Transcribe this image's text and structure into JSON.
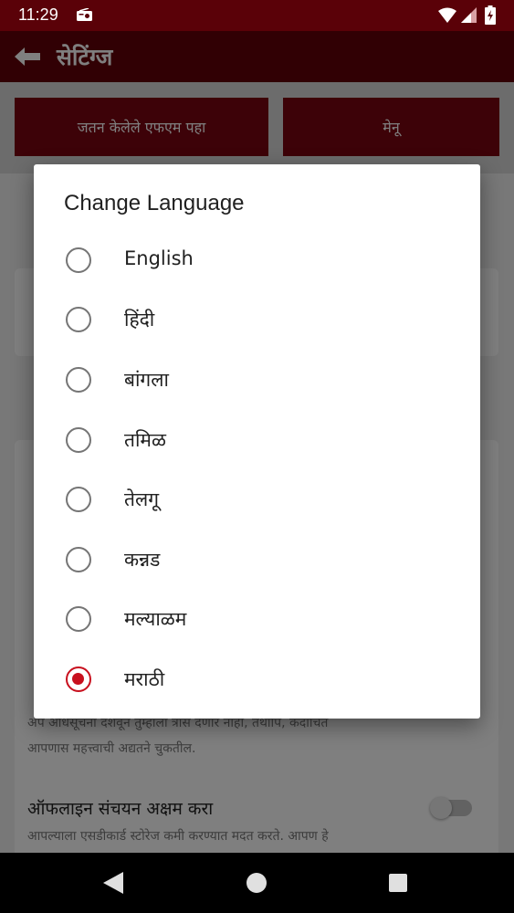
{
  "status_bar": {
    "time": "11:29"
  },
  "app_bar": {
    "title": "सेटिंग्ज"
  },
  "buttons": {
    "saved_fm": "जतन केलेले एफएम पहा",
    "menu": "मेनू"
  },
  "background": {
    "notif_line1": "अप अधिसूचना दर्शवून तुम्हाला त्रास देणार नाही, तथापि, कदाचित",
    "notif_line2": "आपणास महत्त्वाची अद्यतने चुकतील.",
    "offline_title": "ऑफलाइन संचयन अक्षम करा",
    "offline_line1": "आपल्याला एसडीकार्ड स्टोरेज कमी करण्यात मदत करते. आपण हे"
  },
  "dialog": {
    "title": "Change Language",
    "options": [
      {
        "label": "English",
        "selected": false
      },
      {
        "label": "हिंदी",
        "selected": false
      },
      {
        "label": "बांगला",
        "selected": false
      },
      {
        "label": "तमिळ",
        "selected": false
      },
      {
        "label": "तेलगू",
        "selected": false
      },
      {
        "label": "कन्नड",
        "selected": false
      },
      {
        "label": "मल्याळम",
        "selected": false
      },
      {
        "label": "मराठी",
        "selected": true
      }
    ]
  },
  "colors": {
    "primary": "#630109",
    "accent": "#c8101e",
    "status_bar": "#5a0108"
  }
}
